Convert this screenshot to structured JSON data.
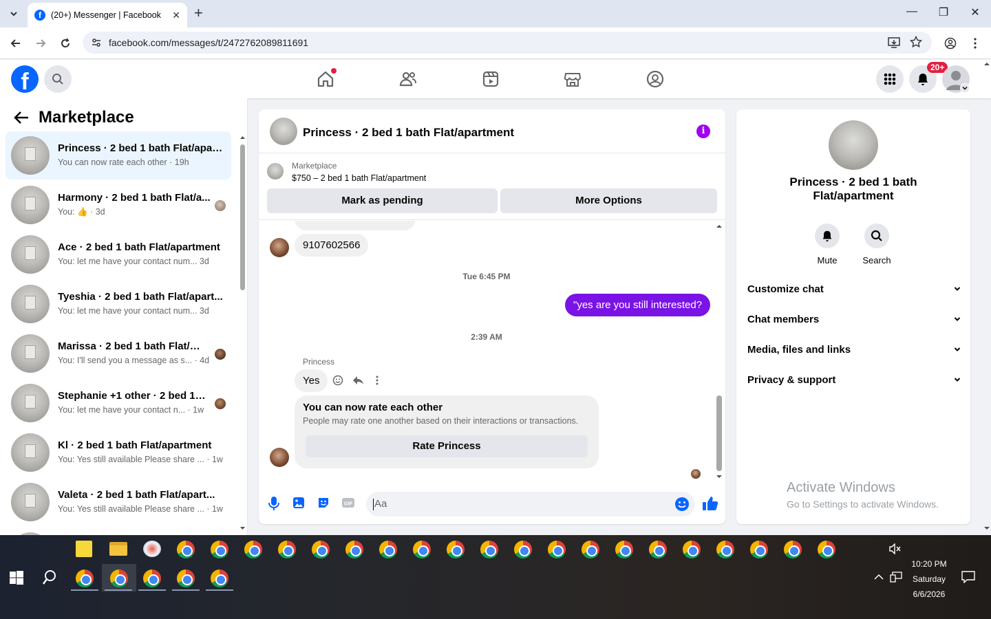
{
  "browser": {
    "tab_title": "(20+) Messenger | Facebook",
    "url": "facebook.com/messages/t/2472762089811691"
  },
  "header": {
    "notifications_badge": "20+"
  },
  "left": {
    "title": "Marketplace",
    "conversations": [
      {
        "name": "Princess · 2 bed 1 bath Flat/apar...",
        "preview": "You can now rate each other · 19h",
        "active": true
      },
      {
        "name": "Harmony · 2 bed 1 bath Flat/a...",
        "preview": "You: 👍 · 3d"
      },
      {
        "name": "Ace · 2 bed 1 bath Flat/apartment",
        "preview": "You: let me have your contact num...   3d"
      },
      {
        "name": "Tyeshia · 2 bed 1 bath Flat/apart...",
        "preview": "You: let me have your contact num...   3d"
      },
      {
        "name": "Marissa · 2 bed 1 bath Flat/ap...",
        "preview": "You: I'll send you a message as s... · 4d"
      },
      {
        "name": "Stephanie +1 other · 2 bed 1 b...",
        "preview": "You: let me have your contact n...  · 1w"
      },
      {
        "name": "Kl · 2 bed 1 bath Flat/apartment",
        "preview": "You: Yes still available Please share ... · 1w"
      },
      {
        "name": "Valeta · 2 bed 1 bath Flat/apart...",
        "preview": "You: Yes still available Please share ... · 1w"
      }
    ]
  },
  "chat": {
    "title": "Princess · 2 bed 1 bath Flat/apartment",
    "marketplace_label": "Marketplace",
    "listing": "$750 – 2 bed 1 bath Flat/apartment",
    "mark_pending": "Mark as pending",
    "more_options": "More Options",
    "msg_phone": "9107602566",
    "ts1": "Tue 6:45 PM",
    "msg_out": "\"yes are you still interested?",
    "ts2": "2:39 AM",
    "sender": "Princess",
    "msg_yes": "Yes",
    "card_title": "You can now rate each other",
    "card_body": "People may rate one another based on their interactions or transactions.",
    "rate_button": "Rate Princess",
    "input_placeholder": "Aa",
    "accent": "#7a13e6"
  },
  "right": {
    "name": "Princess · 2 bed 1 bath Flat/apartment",
    "mute": "Mute",
    "search": "Search",
    "sections": [
      "Customize chat",
      "Chat members",
      "Media, files and links",
      "Privacy & support"
    ]
  },
  "watermark": {
    "line1": "Activate Windows",
    "line2": "Go to Settings to activate Windows."
  },
  "taskbar": {
    "time": "10:20 PM",
    "day": "Saturday",
    "date": "6/6/2026"
  }
}
